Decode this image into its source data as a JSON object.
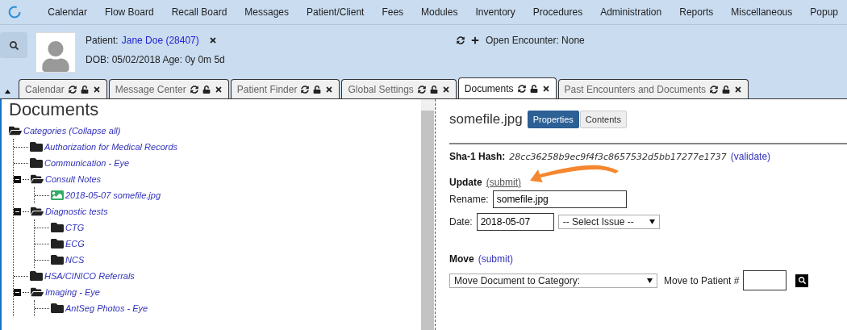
{
  "menu": [
    "Calendar",
    "Flow Board",
    "Recall Board",
    "Messages",
    "Patient/Client",
    "Fees",
    "Modules",
    "Inventory",
    "Procedures",
    "Administration",
    "Reports",
    "Miscellaneous",
    "Popup"
  ],
  "patient": {
    "label": "Patient:",
    "name": "Jane Doe (28407)",
    "dob": "DOB: 05/02/2018 Age: 0y 0m 5d",
    "encounter": "Open Encounter: None"
  },
  "tabs": [
    {
      "label": "Calendar",
      "selected": false
    },
    {
      "label": "Message Center",
      "selected": false
    },
    {
      "label": "Patient Finder",
      "selected": false
    },
    {
      "label": "Global Settings",
      "selected": false
    },
    {
      "label": "Documents",
      "selected": true
    },
    {
      "label": "Past Encounters and Documents",
      "selected": false
    }
  ],
  "sidebar": {
    "title": "Documents",
    "tree": {
      "label": "Categories (Collapse all)",
      "kind": "folder",
      "expanded": true,
      "children": [
        {
          "label": "Authorization for Medical Records",
          "kind": "folder",
          "expanded": false
        },
        {
          "label": "Communication - Eye",
          "kind": "folder",
          "expanded": false
        },
        {
          "label": "Consult Notes",
          "kind": "folder",
          "expanded": true,
          "children": [
            {
              "label": "2018-05-07 somefile.jpg",
              "kind": "file"
            }
          ]
        },
        {
          "label": "Diagnostic tests",
          "kind": "folder",
          "expanded": true,
          "children": [
            {
              "label": "CTG",
              "kind": "folder",
              "expanded": false
            },
            {
              "label": "ECG",
              "kind": "folder",
              "expanded": false
            },
            {
              "label": "NCS",
              "kind": "folder",
              "expanded": false
            }
          ]
        },
        {
          "label": "HSA/CINICO Referrals",
          "kind": "folder",
          "expanded": false
        },
        {
          "label": "Imaging - Eye",
          "kind": "folder",
          "expanded": true,
          "children": [
            {
              "label": "AntSeg Photos - Eye",
              "kind": "folder",
              "expanded": false
            }
          ]
        }
      ]
    }
  },
  "document": {
    "filename": "somefile.jpg",
    "view_tabs": [
      {
        "label": "Properties",
        "selected": true
      },
      {
        "label": "Contents",
        "selected": false
      }
    ],
    "hash_label": "Sha-1 Hash:",
    "hash": "28cc36258b9ec9f4f3c8657532d5bb17277e1737",
    "validate": "(validate)",
    "update_title": "Update",
    "update_submit": "(submit)",
    "rename_label": "Rename:",
    "rename_value": "somefile.jpg",
    "date_label": "Date:",
    "date_value": "2018-05-07",
    "issue_select": "-- Select Issue --",
    "move_title": "Move",
    "move_submit": "(submit)",
    "category_select": "Move Document to Category:",
    "patient_label": "Move to Patient #"
  }
}
